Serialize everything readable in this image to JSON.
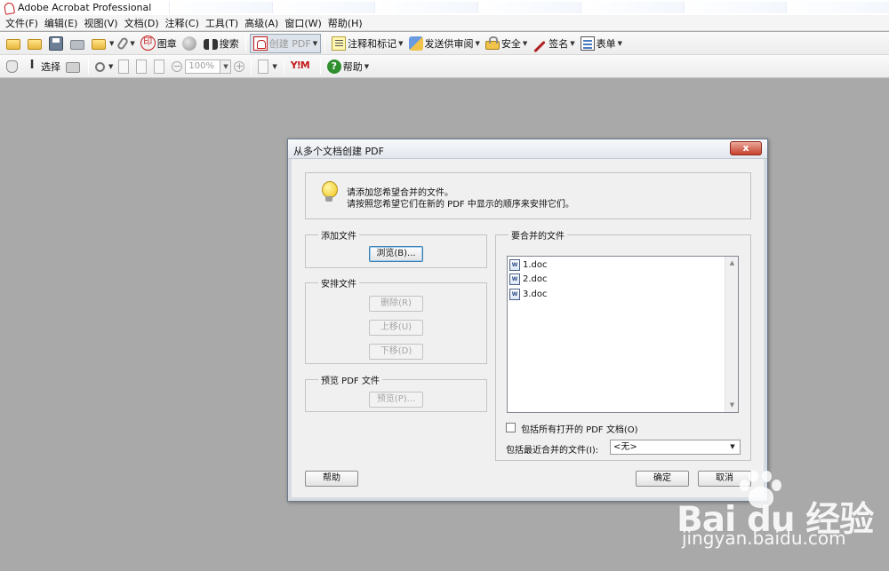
{
  "window": {
    "title": "Adobe Acrobat Professional"
  },
  "menu": [
    "文件(F)",
    "编辑(E)",
    "视图(V)",
    "文档(D)",
    "注释(C)",
    "工具(T)",
    "高级(A)",
    "窗口(W)",
    "帮助(H)"
  ],
  "toolbar1": {
    "stamp_label": "图章",
    "search_label": "搜索",
    "create_pdf_label": "创建 PDF",
    "comment_label": "注释和标记",
    "review_label": "发送供审阅",
    "security_label": "安全",
    "sign_label": "签名",
    "forms_label": "表单"
  },
  "toolbar2": {
    "select_label": "选择",
    "zoom_value": "100%",
    "ym_label": "Y!M",
    "help_label": "帮助"
  },
  "dialog": {
    "title": "从多个文档创建 PDF",
    "close_label": "x",
    "info_line1": "请添加您希望合并的文件。",
    "info_line2": "请按照您希望它们在新的 PDF 中显示的顺序来安排它们。",
    "add_files": {
      "legend": "添加文件",
      "browse_label": "浏览(B)..."
    },
    "arrange_files": {
      "legend": "安排文件",
      "delete_label": "删除(R)",
      "move_up_label": "上移(U)",
      "move_down_label": "下移(D)"
    },
    "preview": {
      "legend": "预览 PDF 文件",
      "preview_label": "预览(P)..."
    },
    "files_to_merge": {
      "legend": "要合并的文件",
      "files": [
        "1.doc",
        "2.doc",
        "3.doc"
      ]
    },
    "include_open_label": "包括所有打开的 PDF 文档(O)",
    "include_recent_label": "包括最近合并的文件(I):",
    "recent_value": "<无>",
    "help_label": "帮助",
    "ok_label": "确定",
    "cancel_label": "取消"
  },
  "watermark": {
    "brand": "Bai du 经验",
    "url": "jingyan.baidu.com"
  }
}
